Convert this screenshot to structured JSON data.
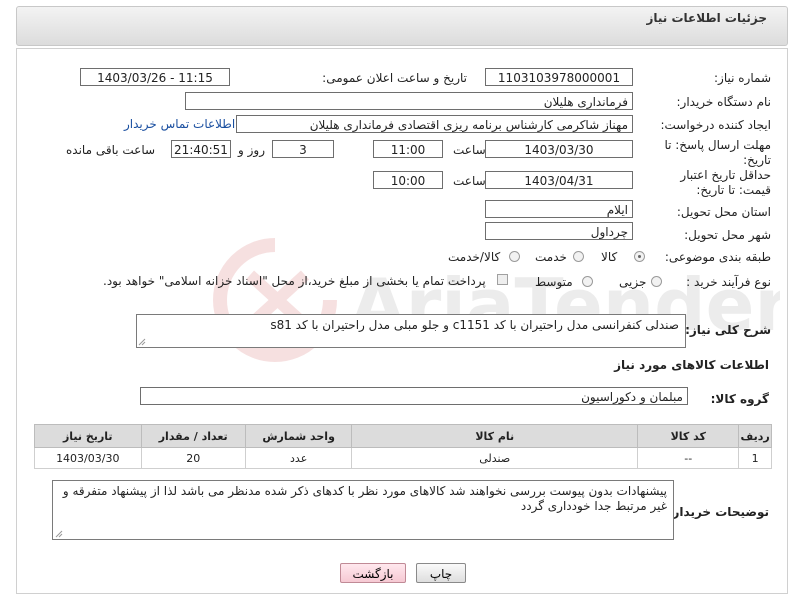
{
  "header": {
    "title": "جزئیات اطلاعات نیاز"
  },
  "watermark": {
    "text": "AriaTender.net"
  },
  "fields": {
    "need_number_label": "شماره نیاز:",
    "need_number": "1103103978000001",
    "announce_label": "تاریخ و ساعت اعلان عمومی:",
    "announce_value": "1403/03/26 - 11:15",
    "buyer_org_label": "نام دستگاه خریدار:",
    "buyer_org": "فرمانداری هلیلان",
    "requester_label": "ایجاد کننده درخواست:",
    "requester": "مهناز شاکرمی کارشناس برنامه ریزی اقتصادی فرمانداری هلیلان",
    "contact_link": "اطلاعات تماس خریدار",
    "deadline_label": "مهلت ارسال پاسخ: تا تاریخ:",
    "deadline_date": "1403/03/30",
    "time_label": "ساعت",
    "deadline_time": "11:00",
    "days_value": "3",
    "days_label": "روز و",
    "remaining_time": "21:40:51",
    "remaining_label": "ساعت باقی مانده",
    "price_validity_label": "حداقل تاریخ اعتبار قیمت: تا تاریخ:",
    "price_validity_date": "1403/04/31",
    "price_validity_time": "10:00",
    "province_label": "استان محل تحویل:",
    "province": "ایلام",
    "city_label": "شهر محل تحویل:",
    "city": "چرداول",
    "category_label": "طبقه بندی موضوعی:",
    "category_options": [
      "کالا",
      "خدمت",
      "کالا/خدمت"
    ],
    "process_label": "نوع فرآیند خرید :",
    "process_options": [
      "جزیی",
      "متوسط"
    ],
    "payment_note": "پرداخت تمام یا بخشی از مبلغ خرید،از محل \"اسناد خزانه اسلامی\" خواهد بود."
  },
  "description": {
    "label": "شرح کلی نیاز:",
    "text": "صندلی کنفرانسی مدل راحتیران با کد c1151 و جلو مبلی مدل راحتیران با کد s81"
  },
  "goods": {
    "section_title": "اطلاعات کالاهای مورد نیاز",
    "group_label": "گروه کالا:",
    "group_value": "مبلمان و دکوراسیون",
    "columns": [
      "ردیف",
      "کد کالا",
      "نام کالا",
      "واحد شمارش",
      "تعداد / مقدار",
      "تاریخ نیاز"
    ],
    "rows": [
      [
        "1",
        "--",
        "صندلی",
        "عدد",
        "20",
        "1403/03/30"
      ]
    ]
  },
  "buyer_notes": {
    "label": "توضیحات خریدار:",
    "text": "پیشنهادات بدون پیوست بررسی نخواهند شد کالاهای مورد نظر با کدهای ذکر شده مدنظر می باشد لذا از پیشنهاد متفرقه و غیر مرتبط جدا خودداری گردد"
  },
  "buttons": {
    "print": "چاپ",
    "back": "بازگشت"
  }
}
